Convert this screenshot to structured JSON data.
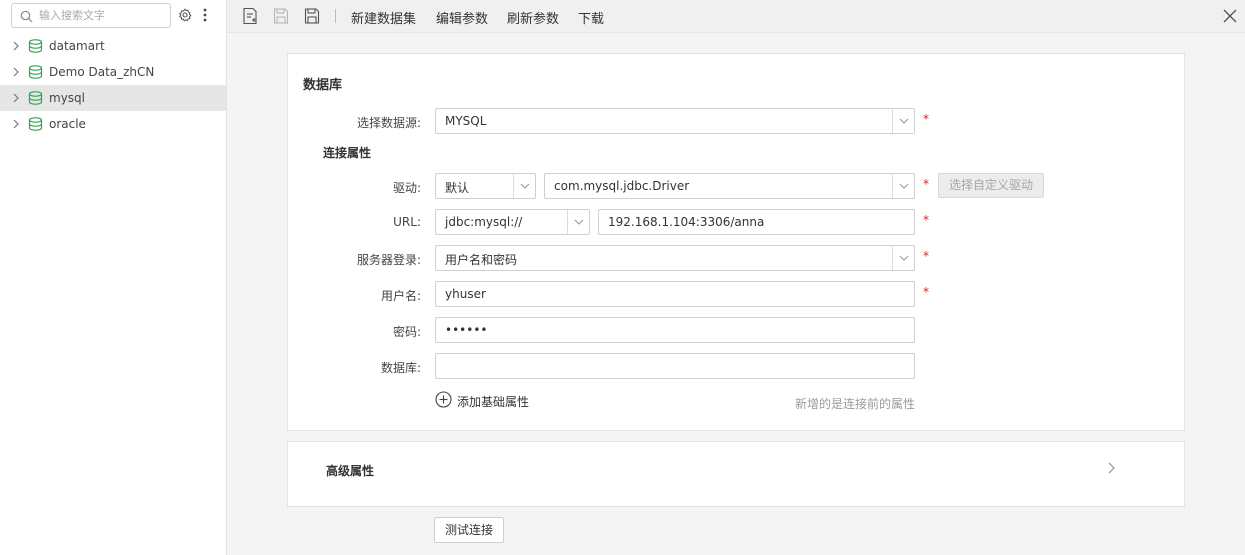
{
  "sidebar": {
    "search_placeholder": "输入搜索文字",
    "items": [
      {
        "label": "datamart",
        "selected": false
      },
      {
        "label": "Demo Data_zhCN",
        "selected": false
      },
      {
        "label": "mysql",
        "selected": true
      },
      {
        "label": "oracle",
        "selected": false
      }
    ],
    "db_icon_color": "#2ea44f"
  },
  "toolbar": {
    "new_dataset": "新建数据集",
    "edit_params": "编辑参数",
    "refresh_params": "刷新参数",
    "download": "下载"
  },
  "form": {
    "section_title": "数据库",
    "datasource_label": "选择数据源:",
    "datasource_value": "MYSQL",
    "conn_props_title": "连接属性",
    "driver_label": "驱动:",
    "driver_type": "默认",
    "driver_class": "com.mysql.jdbc.Driver",
    "custom_driver_button": "选择自定义驱动",
    "url_label": "URL:",
    "url_prefix": "jdbc:mysql://",
    "url_value": "192.168.1.104:3306/anna",
    "server_login_label": "服务器登录:",
    "server_login_value": "用户名和密码",
    "username_label": "用户名:",
    "username_value": "yhuser",
    "password_label": "密码:",
    "password_value": "••••••",
    "database_label": "数据库:",
    "database_value": "",
    "add_basic_attr": "添加基础属性",
    "hint": "新增的是连接前的属性",
    "required_mark": "*"
  },
  "advanced": {
    "title": "高级属性"
  },
  "test_connection": "测试连接"
}
